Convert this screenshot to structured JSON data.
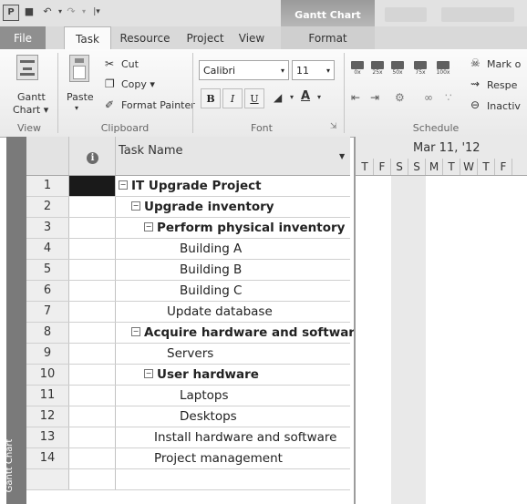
{
  "app": {
    "icon_letter": "P",
    "contextual_tab_title": "Gantt Chart Tools"
  },
  "ribbon_tabs": [
    "File",
    "Task",
    "Resource",
    "Project",
    "View",
    "Format"
  ],
  "ribbon": {
    "view_group": {
      "label": "View",
      "gantt_button": "Gantt",
      "gantt_button_sub": "Chart ▾"
    },
    "clipboard_group": {
      "label": "Clipboard",
      "paste": "Paste",
      "cut": "Cut",
      "copy": "Copy ▾",
      "format_painter": "Format Painter"
    },
    "font_group": {
      "label": "Font",
      "font_name": "Calibri",
      "font_size": "11",
      "bold": "B",
      "italic": "I",
      "underline": "U",
      "font_color": "A"
    },
    "schedule_group": {
      "label": "Schedule",
      "percent_buttons": [
        "0x",
        "25x",
        "50x",
        "75x",
        "100x"
      ],
      "mark_on_track": "Mark o",
      "respect_links": "Respe",
      "inactivate": "Inactiv"
    }
  },
  "grid": {
    "side_label": "Gantt Chart",
    "columns": {
      "info_icon": "i",
      "task_name": "Task Name"
    },
    "rows": [
      {
        "id": "1",
        "name": "IT Upgrade Project",
        "level": 0,
        "summary": true,
        "selected": true
      },
      {
        "id": "2",
        "name": "Upgrade inventory",
        "level": 1,
        "summary": true
      },
      {
        "id": "3",
        "name": "Perform physical inventory",
        "level": 2,
        "summary": true
      },
      {
        "id": "4",
        "name": "Building A",
        "level": 3,
        "summary": false
      },
      {
        "id": "5",
        "name": "Building B",
        "level": 3,
        "summary": false
      },
      {
        "id": "6",
        "name": "Building C",
        "level": 3,
        "summary": false
      },
      {
        "id": "7",
        "name": "Update database",
        "level": 2,
        "summary": false
      },
      {
        "id": "8",
        "name": "Acquire hardware and software",
        "level": 1,
        "summary": true
      },
      {
        "id": "9",
        "name": "Servers",
        "level": 2,
        "summary": false
      },
      {
        "id": "10",
        "name": "User hardware",
        "level": 2,
        "summary": true
      },
      {
        "id": "11",
        "name": "Laptops",
        "level": 3,
        "summary": false
      },
      {
        "id": "12",
        "name": "Desktops",
        "level": 3,
        "summary": false
      },
      {
        "id": "13",
        "name": "Install hardware and software",
        "level": 1,
        "summary": false
      },
      {
        "id": "14",
        "name": "Project management",
        "level": 1,
        "summary": false
      },
      {
        "id": "",
        "name": "",
        "level": 1,
        "summary": false
      }
    ]
  },
  "timeline": {
    "week_label": "Mar 11, '12",
    "days": [
      "T",
      "F",
      "S",
      "S",
      "M",
      "T",
      "W",
      "T",
      "F"
    ],
    "nonworking_days": [
      2,
      3
    ]
  }
}
